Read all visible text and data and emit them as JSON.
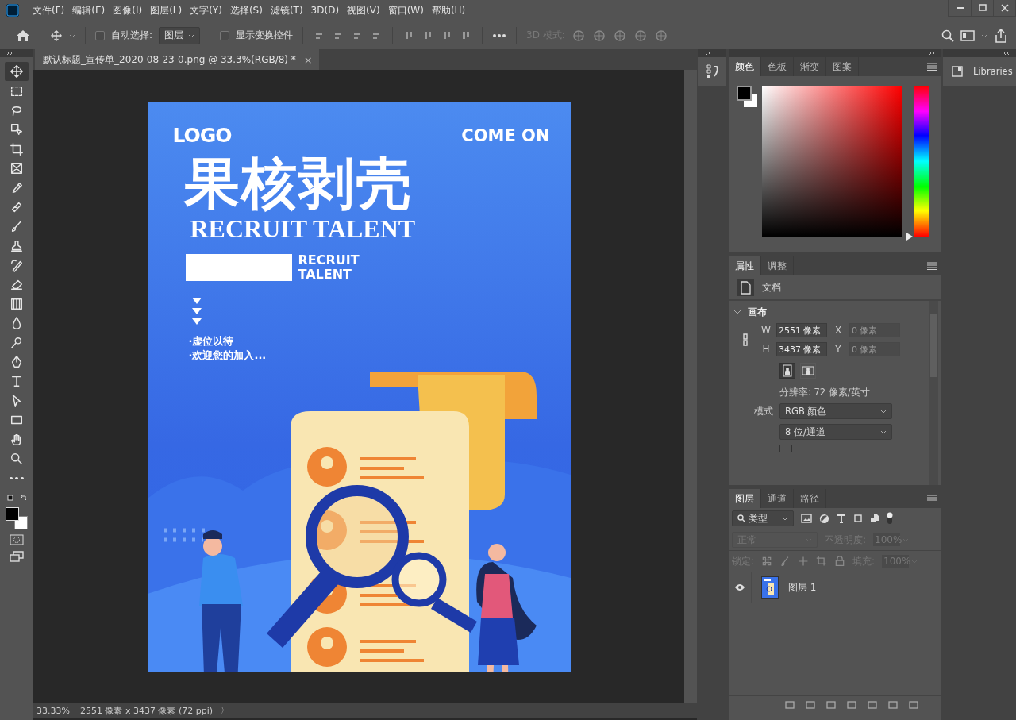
{
  "menu": [
    "文件(F)",
    "编辑(E)",
    "图像(I)",
    "图层(L)",
    "文字(Y)",
    "选择(S)",
    "滤镜(T)",
    "3D(D)",
    "视图(V)",
    "窗口(W)",
    "帮助(H)"
  ],
  "options_bar": {
    "auto_select": {
      "label": "自动选择:",
      "checked": false
    },
    "target": "图层",
    "show_transform": {
      "label": "显示变换控件",
      "checked": false
    },
    "mode_3d": "3D 模式:"
  },
  "tools": [
    {
      "kind": "move",
      "selected": true
    },
    {
      "kind": "marquee",
      "selected": false
    },
    {
      "kind": "lasso",
      "selected": false
    },
    {
      "kind": "select",
      "selected": false
    },
    {
      "kind": "crop",
      "selected": false
    },
    {
      "kind": "frame",
      "selected": false
    },
    {
      "kind": "eyedropper",
      "selected": false
    },
    {
      "kind": "heal",
      "selected": false
    },
    {
      "kind": "brush",
      "selected": false
    },
    {
      "kind": "stamp",
      "selected": false
    },
    {
      "kind": "history",
      "selected": false
    },
    {
      "kind": "eraser",
      "selected": false
    },
    {
      "kind": "gradient",
      "selected": false
    },
    {
      "kind": "blur",
      "selected": false
    },
    {
      "kind": "dodge",
      "selected": false
    },
    {
      "kind": "pen",
      "selected": false
    },
    {
      "kind": "type",
      "selected": false
    },
    {
      "kind": "path",
      "selected": false
    },
    {
      "kind": "shape",
      "selected": false
    },
    {
      "kind": "hand",
      "selected": false
    },
    {
      "kind": "zoom",
      "selected": false
    },
    {
      "kind": "more",
      "selected": false
    }
  ],
  "document": {
    "tab": "默认标题_宣传单_2020-08-23-0.png @ 33.3%(RGB/8) *",
    "close": "×"
  },
  "poster": {
    "logo": "LOGO",
    "corner": "COME ON",
    "headline": "果核剥壳",
    "subtitle": "RECRUIT TALENT",
    "tag": [
      "RECRUIT",
      "TALENT"
    ],
    "bullets": [
      "·虚位以待",
      "·欢迎您的加入..."
    ]
  },
  "status_bar": {
    "zoom": "33.33%",
    "info": "2551 像素 x 3437 像素 (72 ppi)",
    "arrow": "〉"
  },
  "color_panel": {
    "tabs": [
      {
        "label": "颜色",
        "selected": true
      },
      {
        "label": "色板",
        "selected": false
      },
      {
        "label": "渐变",
        "selected": false
      },
      {
        "label": "图案",
        "selected": false
      }
    ],
    "hue": {
      "level": 0
    }
  },
  "libraries": "Libraries",
  "properties": {
    "tabs": [
      {
        "label": "属性",
        "selected": true
      },
      {
        "label": "调整",
        "selected": false
      }
    ],
    "doc_label": "文档",
    "section": {
      "title": "画布",
      "expanded": true
    },
    "fields": [
      {
        "label": "W",
        "value": "2551 像素",
        "disabled": false
      },
      {
        "label": "X",
        "value": "0 像素",
        "disabled": true
      },
      {
        "label": "H",
        "value": "3437 像素",
        "disabled": false
      },
      {
        "label": "Y",
        "value": "0 像素",
        "disabled": true
      }
    ],
    "orientations": [
      {
        "kind": "portrait",
        "selected": true
      },
      {
        "kind": "landscape",
        "selected": false
      }
    ],
    "resolution": "分辨率: 72 像素/英寸",
    "mode_label": "模式",
    "mode": "RGB 颜色",
    "depth": "8 位/通道"
  },
  "layers_panel": {
    "tabs": [
      {
        "label": "图层",
        "selected": true
      },
      {
        "label": "通道",
        "selected": false
      },
      {
        "label": "路径",
        "selected": false
      }
    ],
    "filter": "类型",
    "blend": "正常",
    "opacity_label": "不透明度:",
    "opacity": "100%",
    "lock_label": "锁定:",
    "fill_label": "填充:",
    "fill": "100%",
    "layers": [
      {
        "name": "图层 1",
        "visible": true
      }
    ]
  }
}
